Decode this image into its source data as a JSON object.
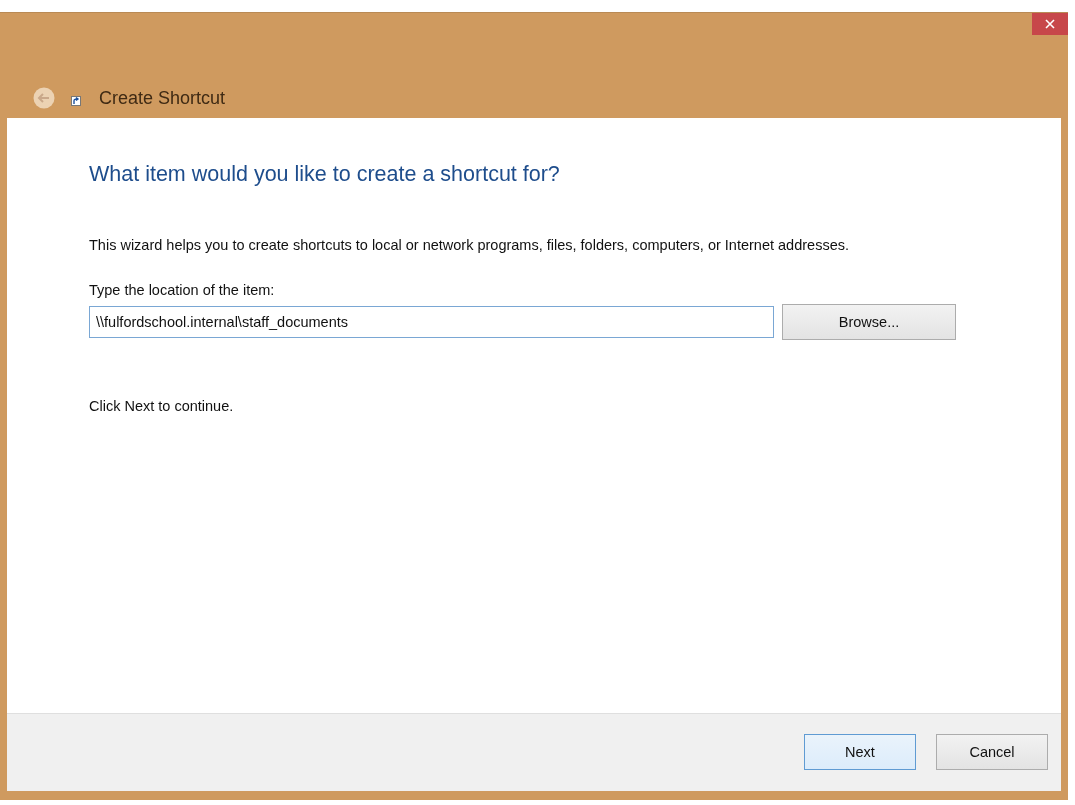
{
  "window": {
    "title": "Create Shortcut"
  },
  "heading": "What item would you like to create a shortcut for?",
  "description": "This wizard helps you to create shortcuts to local or network programs, files, folders, computers, or Internet addresses.",
  "location": {
    "label": "Type the location of the item:",
    "value": "\\\\fulfordschool.internal\\staff_documents",
    "browse": "Browse..."
  },
  "hint": "Click Next to continue.",
  "buttons": [
    {
      "label": "Next",
      "kind": "default"
    },
    {
      "label": "Cancel",
      "kind": "normal"
    }
  ]
}
